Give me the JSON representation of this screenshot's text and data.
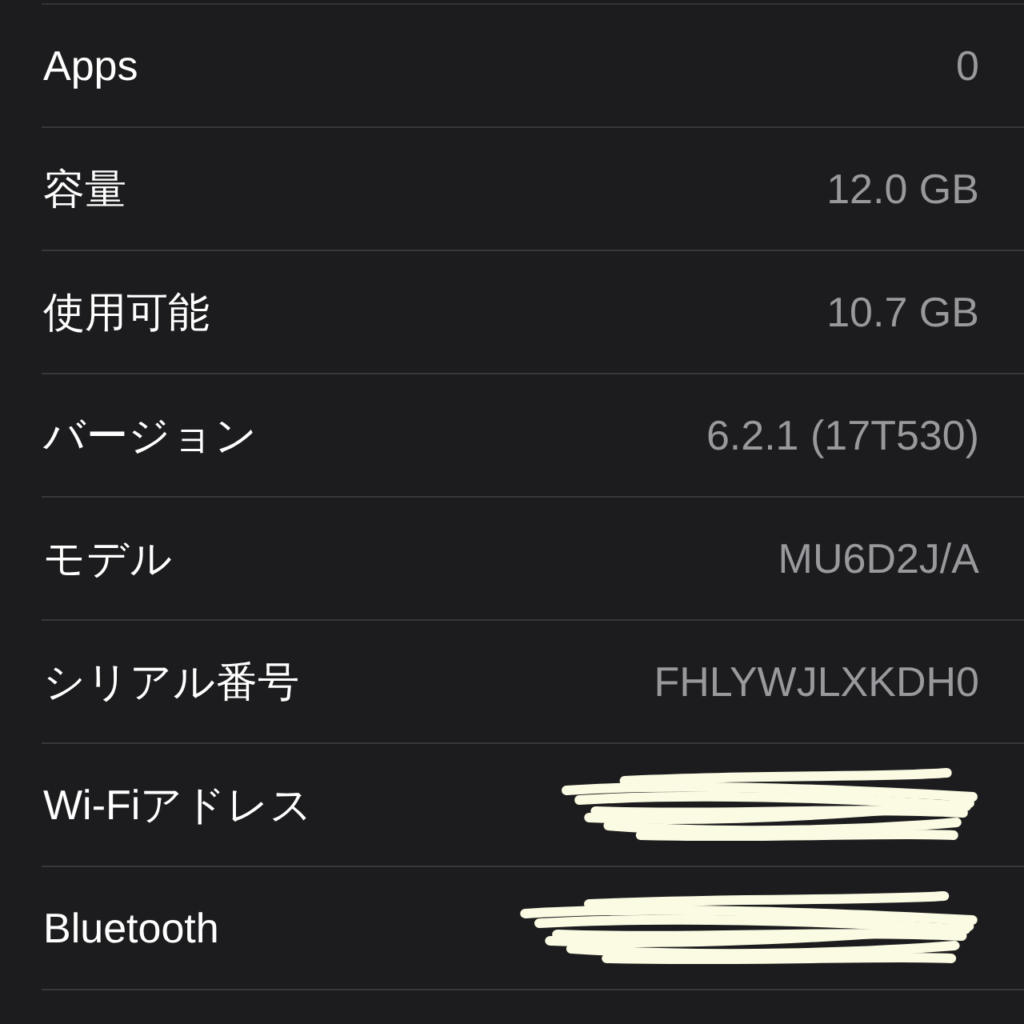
{
  "rows": [
    {
      "kind": "value",
      "label": "Apps",
      "value": "0"
    },
    {
      "kind": "value",
      "label": "容量",
      "value": "12.0 GB"
    },
    {
      "kind": "value",
      "label": "使用可能",
      "value": "10.7 GB"
    },
    {
      "kind": "value",
      "label": "バージョン",
      "value": "6.2.1 (17T530)"
    },
    {
      "kind": "value",
      "label": "モデル",
      "value": "MU6D2J/A"
    },
    {
      "kind": "value",
      "label": "シリアル番号",
      "value": "FHLYWJLXKDH0"
    },
    {
      "kind": "scribbled",
      "label": "Wi-Fiアドレス"
    },
    {
      "kind": "scribbled",
      "label": "Bluetooth"
    }
  ]
}
